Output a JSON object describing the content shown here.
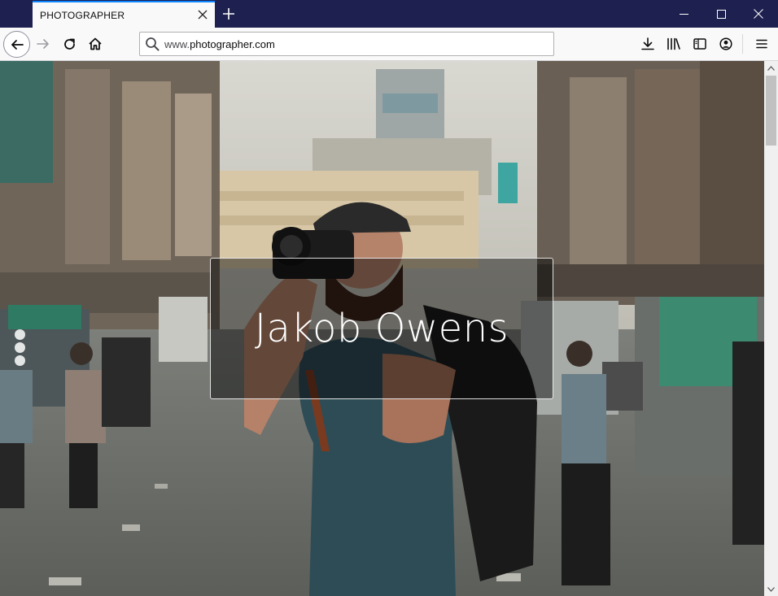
{
  "window": {
    "tab_title": "PHOTOGRAPHER",
    "controls": [
      "minimize",
      "maximize",
      "close"
    ]
  },
  "toolbar": {
    "url_prefix": "www.",
    "url_host": "photographer.com",
    "icons": [
      "back-arrow-icon",
      "forward-arrow-icon",
      "reload-icon",
      "home-icon",
      "search-icon",
      "download-icon",
      "library-icon",
      "sidebar-icon",
      "account-icon",
      "hamburger-menu-icon"
    ]
  },
  "page": {
    "hero_name": "Jakob Owens",
    "slider_dots": 3,
    "background_photo": "street photographer holding camera"
  },
  "colors": {
    "titlebar": "#1e2150",
    "tab_accent": "#0a84ff",
    "toolbar": "#f9f9fa",
    "hero_text": "#ffffff"
  }
}
